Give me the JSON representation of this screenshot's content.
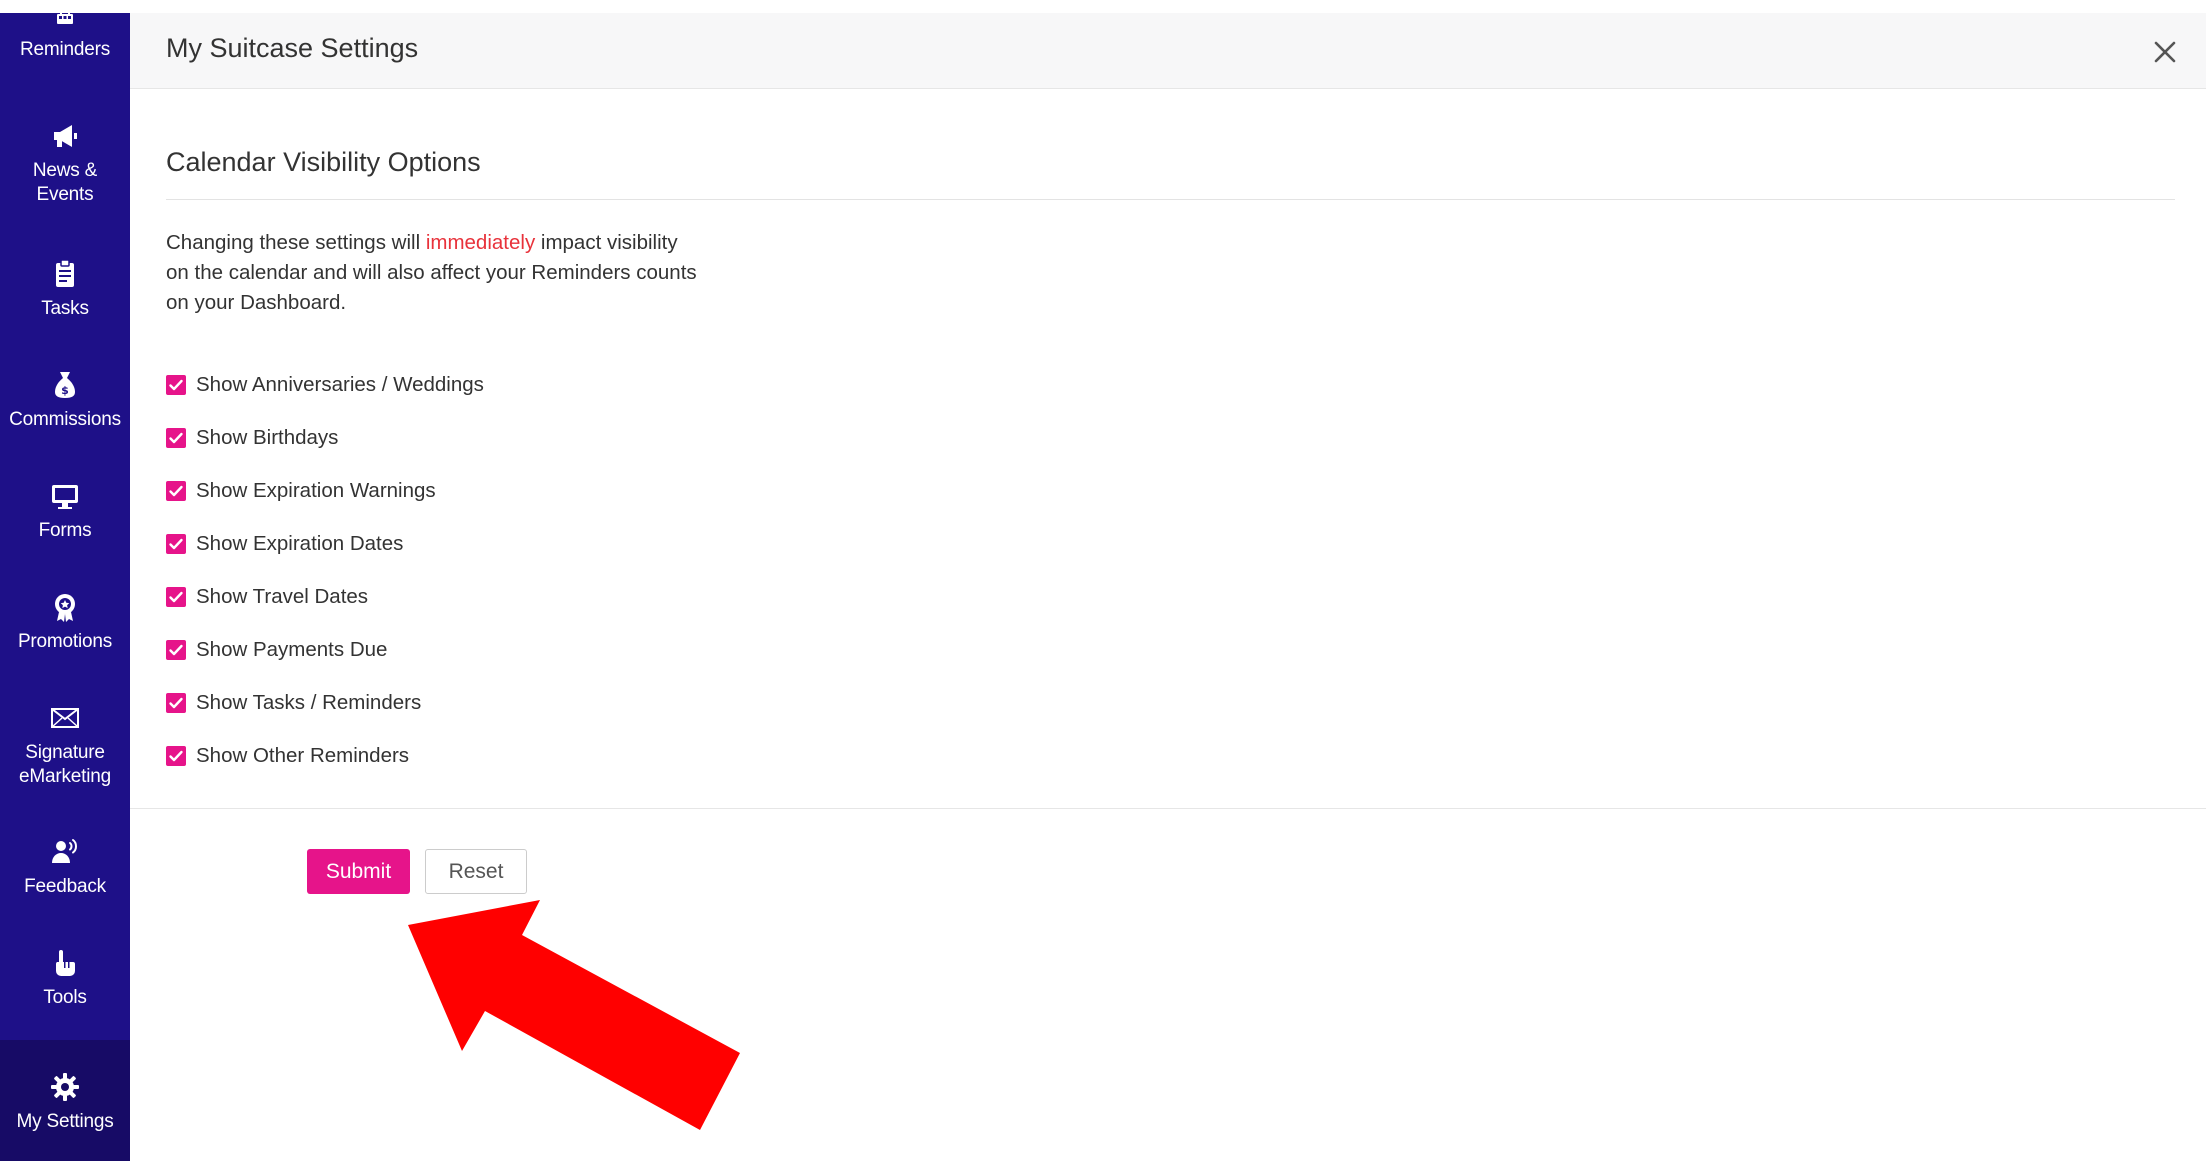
{
  "sidebar": {
    "items": [
      {
        "label": "Reminders",
        "icon": "calendar-icon"
      },
      {
        "label": "News & Events",
        "icon": "megaphone-icon"
      },
      {
        "label": "Tasks",
        "icon": "clipboard-icon"
      },
      {
        "label": "Commissions",
        "icon": "money-bag-icon"
      },
      {
        "label": "Forms",
        "icon": "monitor-icon"
      },
      {
        "label": "Promotions",
        "icon": "award-icon"
      },
      {
        "label": "Signature eMarketing",
        "icon": "envelope-icon"
      },
      {
        "label": "Feedback",
        "icon": "speaking-person-icon"
      },
      {
        "label": "Tools",
        "icon": "pointing-hand-icon"
      },
      {
        "label": "My Settings",
        "icon": "gear-icon",
        "active": true
      }
    ],
    "background": "#1e1088",
    "active_background": "#170b66"
  },
  "header": {
    "title": "My Suitcase Settings"
  },
  "section": {
    "title": "Calendar Visibility Options",
    "description_before": "Changing these settings will ",
    "description_highlight": "immediately",
    "description_after": " impact visibility on the calendar and will also affect your Reminders counts on your Dashboard.",
    "highlight_color": "#e8323b"
  },
  "options": [
    {
      "label": "Show Anniversaries / Weddings",
      "checked": true
    },
    {
      "label": "Show Birthdays",
      "checked": true
    },
    {
      "label": "Show Expiration Warnings",
      "checked": true
    },
    {
      "label": "Show Expiration Dates",
      "checked": true
    },
    {
      "label": "Show Travel Dates",
      "checked": true
    },
    {
      "label": "Show Payments Due",
      "checked": true
    },
    {
      "label": "Show Tasks / Reminders",
      "checked": true
    },
    {
      "label": "Show Other Reminders",
      "checked": true
    }
  ],
  "buttons": {
    "submit_label": "Submit",
    "reset_label": "Reset"
  },
  "colors": {
    "accent": "#e6148a",
    "annotation_arrow": "#ff0000"
  }
}
